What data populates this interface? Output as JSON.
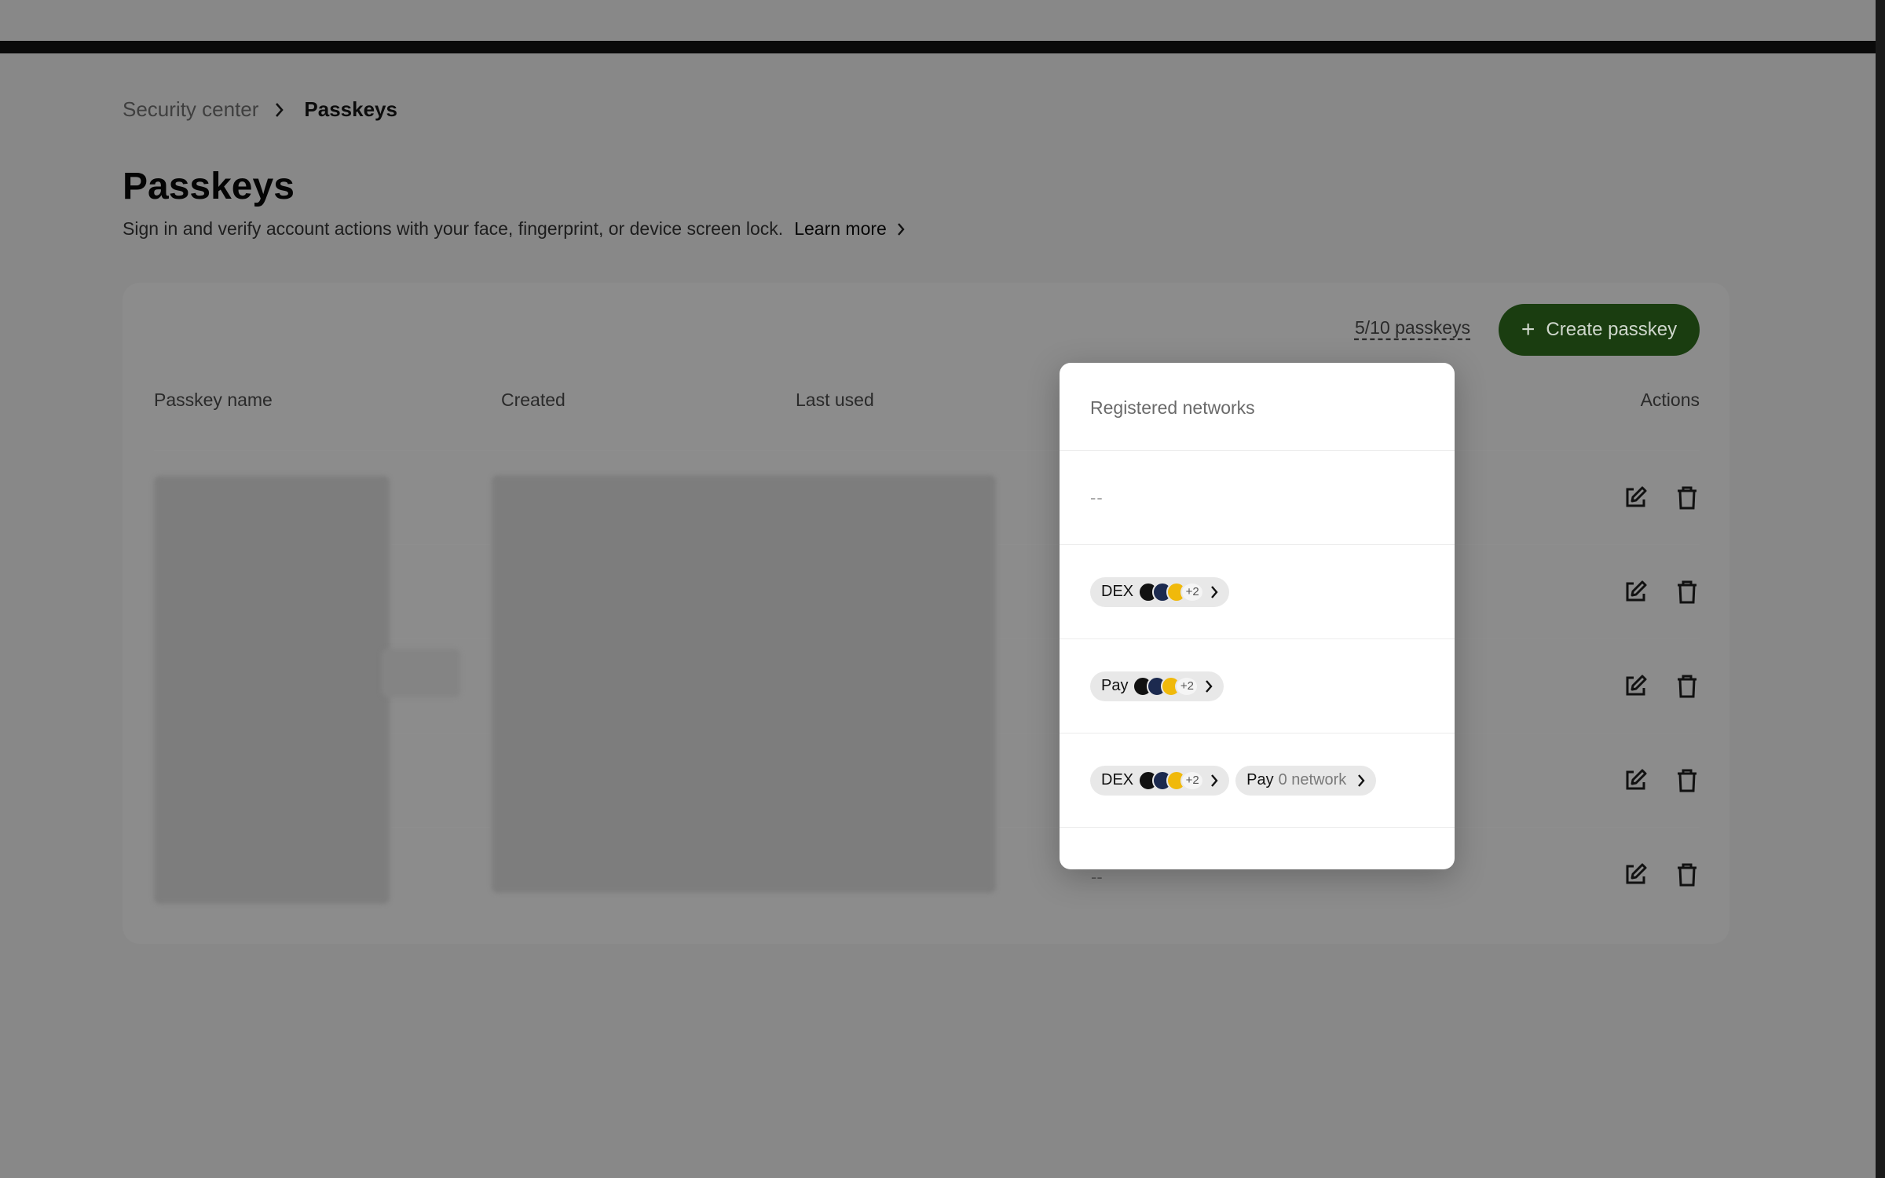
{
  "breadcrumb": {
    "parent": "Security center",
    "current": "Passkeys"
  },
  "header": {
    "title": "Passkeys",
    "subtitle": "Sign in and verify account actions with your face, fingerprint, or device screen lock.",
    "learn_more": "Learn more"
  },
  "toolbar": {
    "count": "5/10 passkeys",
    "create_label": "Create passkey"
  },
  "table": {
    "columns": {
      "name": "Passkey name",
      "created": "Created",
      "last_used": "Last used",
      "actions": "Actions"
    },
    "last_row_network": "--"
  },
  "popover": {
    "title": "Registered networks",
    "row1": {
      "empty": "--"
    },
    "row2": {
      "pill_label": "DEX",
      "more": "+2"
    },
    "row3": {
      "pill_label": "Pay",
      "more": "+2"
    },
    "row4": {
      "pill1_label": "DEX",
      "pill1_more": "+2",
      "pill2_label": "Pay",
      "pill2_value": "0 network"
    }
  },
  "icons": {
    "chevron": "chevron-right-icon",
    "edit": "edit-icon",
    "delete": "trash-icon",
    "plus": "plus-icon",
    "coins": [
      "okx-icon",
      "ethereum-icon",
      "bnb-icon"
    ]
  },
  "colors": {
    "overlay": "#888888",
    "accent": "#1a3d10",
    "popover_bg": "#ffffff",
    "pill_bg": "#e8e8e8"
  }
}
